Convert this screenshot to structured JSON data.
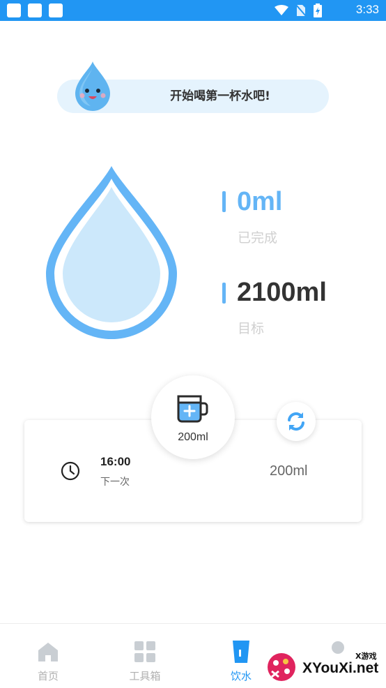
{
  "status_bar": {
    "time": "3:33",
    "icons": [
      "notification-icon",
      "notification-icon",
      "notification-icon",
      "wifi-icon",
      "no-sim-icon",
      "battery-charging-icon"
    ]
  },
  "banner": {
    "message": "开始喝第一杯水吧!",
    "mascot_icon": "water-drop-mascot-icon"
  },
  "progress": {
    "completed_value": "0ml",
    "completed_label": "已完成",
    "goal_value": "2100ml",
    "goal_label": "目标",
    "fill_fraction": 0
  },
  "add_cup": {
    "amount_label": "200ml",
    "icon": "cup-plus-icon"
  },
  "refresh": {
    "icon": "refresh-icon"
  },
  "next_reminder": {
    "time": "16:00",
    "label": "下一次",
    "amount": "200ml",
    "icon": "clock-icon"
  },
  "bottom_nav": {
    "items": [
      {
        "label": "首页",
        "icon": "home-icon",
        "active": false
      },
      {
        "label": "工具箱",
        "icon": "grid-icon",
        "active": false
      },
      {
        "label": "饮水",
        "icon": "water-cup-icon",
        "active": true
      },
      {
        "label": "",
        "icon": "profile-icon",
        "active": false
      }
    ]
  },
  "watermark": {
    "text": "XYouXi.net",
    "sub": "X游戏"
  },
  "colors": {
    "accent": "#2196f3",
    "drop_outer": "#64b5f6",
    "drop_inner": "#cce8fb",
    "banner_bg": "#e5f3fd",
    "muted_text": "#d0d0d0"
  }
}
